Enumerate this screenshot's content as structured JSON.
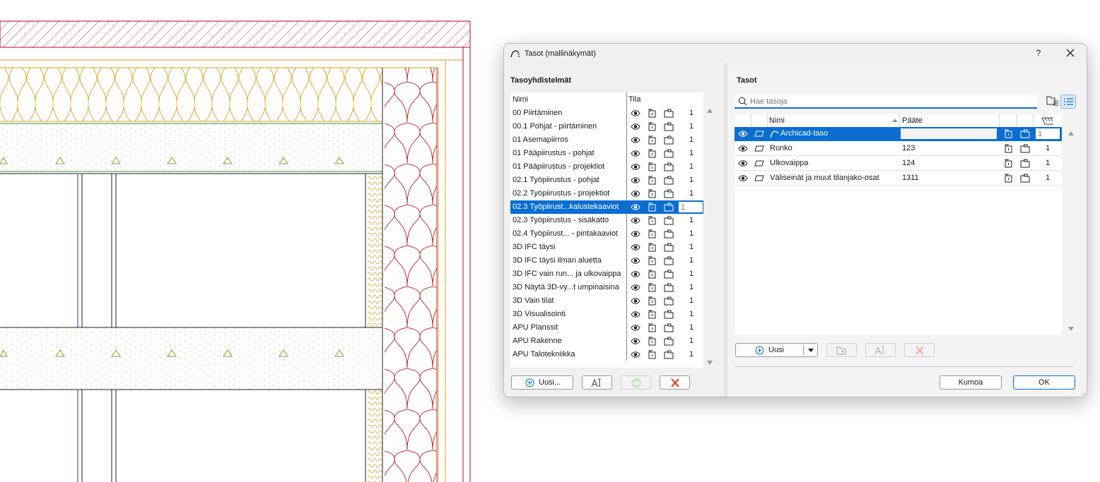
{
  "dialog": {
    "title": "Tasot (mallinäkymät)",
    "help_label": "?",
    "accent_color": "#0a6ed1"
  },
  "combinations": {
    "section_title": "Tasoyhdistelmät",
    "col_name": "Nimi",
    "col_state": "Tila",
    "items": [
      {
        "label": "00 Piirtäminen",
        "num": "1"
      },
      {
        "label": "00.1 Pohjat - piirtäminen",
        "num": "1"
      },
      {
        "label": "01 Asemapiirros",
        "num": "1"
      },
      {
        "label": "01 Pääpiirustus - pohjat",
        "num": "1"
      },
      {
        "label": "01 Pääpiirustus - projektiot",
        "num": "1"
      },
      {
        "label": "02.1 Työpiirustus - pohjat",
        "num": "1"
      },
      {
        "label": "02.2 Työpiirustus - projektiot",
        "num": "1"
      },
      {
        "label": "02.3 Työpiirust...kalustekaaviot",
        "num": "1",
        "selected": true
      },
      {
        "label": "02.3 Työpiirustus - sisäkatto",
        "num": "1"
      },
      {
        "label": "02.4 Työpiirust... - pintakaaviot",
        "num": "1"
      },
      {
        "label": "3D IFC täysi",
        "num": "1"
      },
      {
        "label": "3D IFC täysi ilman aluetta",
        "num": "1"
      },
      {
        "label": "3D IFC vain run... ja ulkovaippa",
        "num": "1"
      },
      {
        "label": "3D Näytä 3D-vy...t umpinaisina",
        "num": "1"
      },
      {
        "label": "3D Vain tilat",
        "num": "1"
      },
      {
        "label": "3D Visualisointi",
        "num": "1"
      },
      {
        "label": "APU Planssit",
        "num": "1"
      },
      {
        "label": "APU Rakenne",
        "num": "1"
      },
      {
        "label": "APU Talotekniikka",
        "num": "1"
      }
    ],
    "new_button": "Uusi..."
  },
  "layers": {
    "section_title": "Tasot",
    "search_placeholder": "Hae tasoja",
    "col_name": "Nimi",
    "col_ext": "Pääte",
    "rows": [
      {
        "name": "Archicad-taso",
        "ext": "",
        "num": "1",
        "selected": true
      },
      {
        "name": "Runko",
        "ext": "123",
        "num": "1"
      },
      {
        "name": "Ulkovaippa",
        "ext": "124",
        "num": "1"
      },
      {
        "name": "Väliseinät ja muut tilanjako-osat",
        "ext": "1311",
        "num": "1"
      }
    ],
    "new_button": "Uusi"
  },
  "footer": {
    "cancel_button": "Kumoa",
    "ok_button": "OK"
  }
}
